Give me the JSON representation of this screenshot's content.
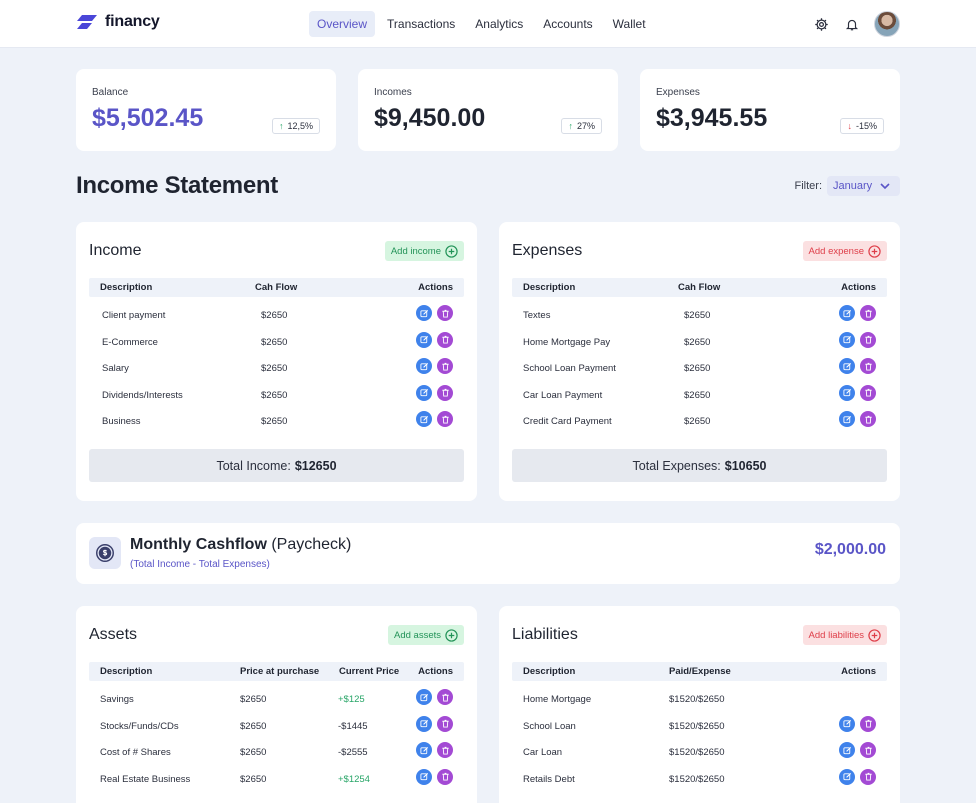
{
  "brand": {
    "name": "financy",
    "accent": "#5a55c7"
  },
  "nav": [
    "Overview",
    "Transactions",
    "Analytics",
    "Accounts",
    "Wallet"
  ],
  "stats": [
    {
      "label": "Balance",
      "value": "$5,502.45",
      "badge": "12,5%",
      "trend": "up"
    },
    {
      "label": "Incomes",
      "value": "$9,450.00",
      "badge": "27%",
      "trend": "up"
    },
    {
      "label": "Expenses",
      "value": "$3,945.55",
      "badge": "-15%",
      "trend": "down"
    }
  ],
  "statement": {
    "title": "Income Statement",
    "filter_label": "Filter:",
    "filter_value": "January"
  },
  "income": {
    "title": "Income",
    "add_label": "Add income",
    "headers": [
      "Description",
      "Cah Flow",
      "Actions"
    ],
    "rows": [
      {
        "desc": "Client payment",
        "amount": "$2650"
      },
      {
        "desc": "E-Commerce",
        "amount": "$2650"
      },
      {
        "desc": "Salary",
        "amount": "$2650"
      },
      {
        "desc": "Dividends/Interests",
        "amount": "$2650"
      },
      {
        "desc": "Business",
        "amount": "$2650"
      }
    ],
    "total_label": "Total Income:",
    "total_value": "$12650"
  },
  "expenses": {
    "title": "Expenses",
    "add_label": "Add expense",
    "headers": [
      "Description",
      "Cah Flow",
      "Actions"
    ],
    "rows": [
      {
        "desc": "Textes",
        "amount": "$2650"
      },
      {
        "desc": "Home Mortgage Pay",
        "amount": "$2650"
      },
      {
        "desc": "School Loan Payment",
        "amount": "$2650"
      },
      {
        "desc": "Car Loan Payment",
        "amount": "$2650"
      },
      {
        "desc": "Credit Card Payment",
        "amount": "$2650"
      }
    ],
    "total_label": "Total Expenses:",
    "total_value": "$10650"
  },
  "cashflow": {
    "title": "Monthly Cashflow",
    "title_paren": "(Paycheck)",
    "subtitle": "(Total Income - Total Expenses)",
    "value": "$2,000.00"
  },
  "assets": {
    "title": "Assets",
    "add_label": "Add assets",
    "headers": [
      "Description",
      "Price at purchase",
      "Current Price",
      "Actions"
    ],
    "rows": [
      {
        "desc": "Savings",
        "price": "$2650",
        "current": "+$125",
        "trend": "up"
      },
      {
        "desc": "Stocks/Funds/CDs",
        "price": "$2650",
        "current": "-$1445",
        "trend": "down"
      },
      {
        "desc": "Cost of # Shares",
        "price": "$2650",
        "current": "-$2555",
        "trend": "down"
      },
      {
        "desc": "Real Estate Business",
        "price": "$2650",
        "current": "+$1254",
        "trend": "up"
      }
    ]
  },
  "liabilities": {
    "title": "Liabilities",
    "add_label": "Add liabilities",
    "headers": [
      "Description",
      "Paid/Expense",
      "Actions"
    ],
    "rows": [
      {
        "desc": "Home Mortgage",
        "paid": "$1520/$2650"
      },
      {
        "desc": "School Loan",
        "paid": "$1520/$2650"
      },
      {
        "desc": "Car Loan",
        "paid": "$1520/$2650"
      },
      {
        "desc": "Retails Debt",
        "paid": "$1520/$2650"
      }
    ]
  },
  "colors": {
    "green": "#27a567",
    "red": "#e0454f",
    "edit": "#3f82eb",
    "delete": "#a34ad4"
  }
}
